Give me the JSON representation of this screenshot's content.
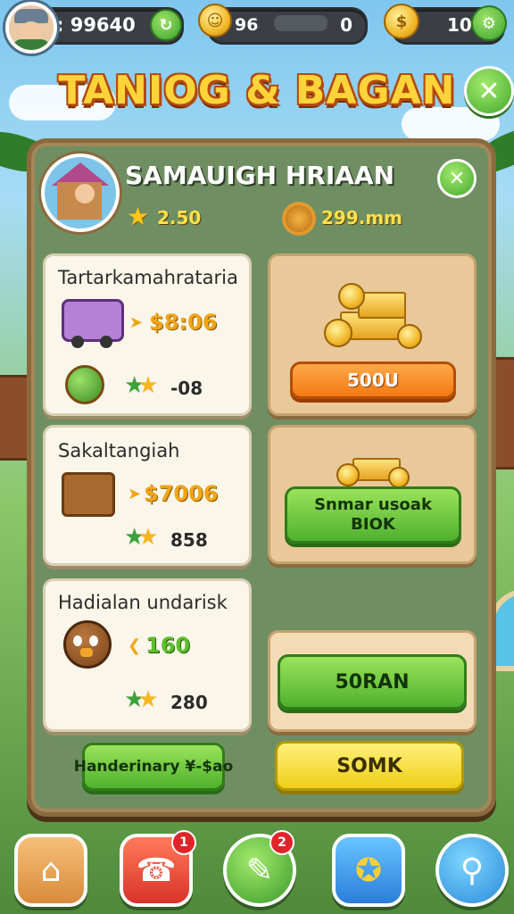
{
  "hud": {
    "coins_value": ": 99640",
    "smiles_value": "96",
    "middle_counter": "0",
    "right_value": "10"
  },
  "title": "TANIOG & BAGAN",
  "profile": {
    "name": "SAMAUIGH HRIAAN",
    "stars": "2.50",
    "resource": "299.mm"
  },
  "offers": [
    {
      "title": "Tartarkamahrataria",
      "price": "$8:06",
      "stars_value": "-08"
    },
    {
      "title": "Sakaltangiah",
      "price": "$7006",
      "stars_value": "858"
    },
    {
      "title": "Hadialan undarisk",
      "price": "160",
      "stars_value": "280"
    }
  ],
  "rewards": [
    {
      "button": "500U"
    },
    {
      "button_line1": "Snmar usoak",
      "button_line2": "BIOK"
    },
    {
      "button": "50RAN"
    }
  ],
  "footer": {
    "left_button": "Handerinary ¥-$ao",
    "right_button": "SOMK"
  },
  "nav": {
    "badge_shop": "1",
    "badge_chat": "2"
  },
  "colors": {
    "panel": "#6f8f62",
    "frame": "#8b6a3e",
    "card": "#fbf6ea",
    "accent_gold": "#ffd43a",
    "button_green": "#4fb12e",
    "button_orange": "#f27a12",
    "button_yellow": "#f0cf18"
  }
}
